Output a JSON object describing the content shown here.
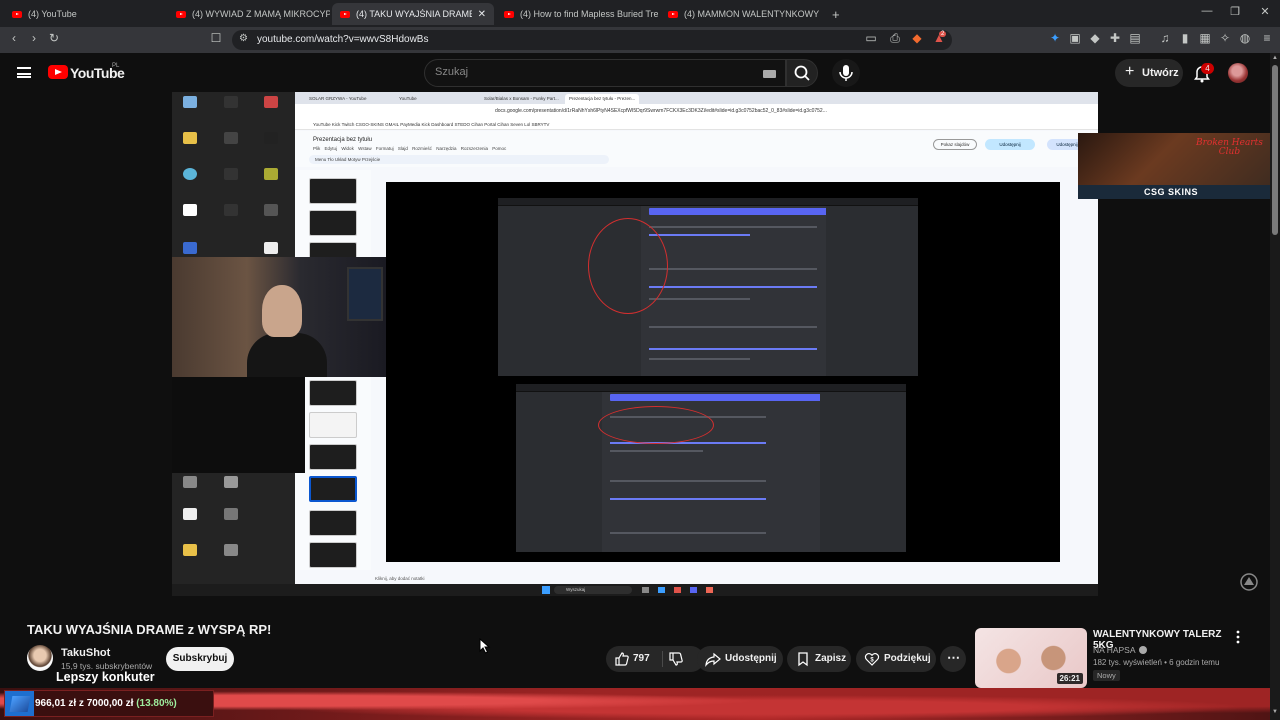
{
  "browser": {
    "tabs": [
      {
        "title": "(4) YouTube",
        "active": false
      },
      {
        "title": "(4) WYWIAD Z MAMĄ MIKROCYPKA",
        "active": false
      },
      {
        "title": "(4) TAKU WYAJŚNIA DRAME z",
        "active": true
      },
      {
        "title": "(4) How to find Mapless Buried Treas",
        "active": false
      },
      {
        "title": "(4) MAMMON WALENTYNKOWY MIX",
        "active": false
      }
    ],
    "new_tab_label": "+",
    "url": "youtube.com/watch?v=wwvS8HdowBs",
    "extension_badge": "2"
  },
  "youtube": {
    "logo_text": "YouTube",
    "country_code": "PL",
    "search_placeholder": "Szukaj",
    "create_label": "Utwórz",
    "notifications_count": "4"
  },
  "inner_browser": {
    "tabs": [
      "SOLAR GRZYWA - YouTube",
      "YouTube",
      "Solar/Bialas x Bonsam - Funky Part...",
      "Prezentacja bez tytułu - Prezen..."
    ],
    "url": "docs.google.com/presentation/d/1rRaNhYsh6lPtyN4SEXcpfWI5Dqr9Swrwm7FCKX3Ec3DK3Zi/edit#slide=id.g3c0752bac52_0_83#slide=id.g3c0752...",
    "bookmarks": "YouTube  Kick  Twitch  CSGO-SKINS  GMAIL  PayMedia  Kick Dashboard  STEDO  Cihan Portal  Cihan Seven Lol  SBRYTV",
    "doc_title": "Prezentacja bez tytułu",
    "menu": [
      "Plik",
      "Edytuj",
      "Widok",
      "Wstaw",
      "Formatuj",
      "Slajd",
      "Rozmieść",
      "Narzędzia",
      "Rozszerzenia",
      "Pomoc"
    ],
    "slides_toolbar": "Menu   Tło   Układ   Motyw   Przejście",
    "present_label": "Pokaz slajdów",
    "slideshow_label": "Udostępnij",
    "share_label": "Udostępnij",
    "speaker_notes": "Kliknij, aby dodać notatki",
    "taskbar_search": "Wyszukaj"
  },
  "sponsor": {
    "title_line1": "Broken Hearts",
    "title_line2": "Club",
    "brand": "CSG SKINS"
  },
  "video": {
    "title": "TAKU WYAJŚNIA DRAME z WYSPĄ RP!",
    "channel": "TakuShot",
    "subscribers": "15,9 tys. subskrybentów",
    "subscribe_label": "Subskrybuj",
    "overlay_text": "Lepszy konkuter",
    "likes": "797",
    "share_label": "Udostępnij",
    "save_label": "Zapisz",
    "thanks_label": "Podziękuj"
  },
  "recommended": {
    "title": "WALENTYNKOWY TALERZ 5KG",
    "channel": "NA HAPSA",
    "meta": "182 tys. wyświetleń • 6 godzin temu",
    "badge": "Nowy",
    "duration": "26:21"
  },
  "donation": {
    "text": "966,01 zł z 7000,00 zł",
    "percent_label": "(13.80%)",
    "progress": 0.138
  },
  "colors": {
    "youtube_red": "#ff0000",
    "accent_blue": "#1e6fd0",
    "discord_blurple": "#5865f2"
  }
}
